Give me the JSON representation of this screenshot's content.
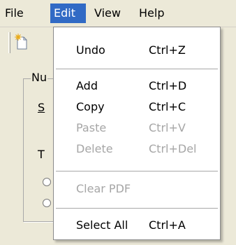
{
  "menubar": {
    "items": [
      {
        "label": "File"
      },
      {
        "label": "Edit"
      },
      {
        "label": "View"
      },
      {
        "label": "Help"
      }
    ]
  },
  "background": {
    "group_label": "Nu",
    "label_s": "S",
    "label_t": "T"
  },
  "edit_menu": {
    "items": [
      {
        "label": "Undo",
        "shortcut": "Ctrl+Z",
        "enabled": true
      },
      {
        "label": "Add",
        "shortcut": "Ctrl+D",
        "enabled": true
      },
      {
        "label": "Copy",
        "shortcut": "Ctrl+C",
        "enabled": true
      },
      {
        "label": "Paste",
        "shortcut": "Ctrl+V",
        "enabled": false
      },
      {
        "label": "Delete",
        "shortcut": "Ctrl+Del",
        "enabled": false
      },
      {
        "label": "Clear PDF",
        "shortcut": "",
        "enabled": false
      },
      {
        "label": "Select All",
        "shortcut": "Ctrl+A",
        "enabled": true
      }
    ]
  },
  "colors": {
    "highlight": "#316ac5",
    "disabled_text": "#a6a6a6",
    "menu_background": "#ffffff",
    "window_background": "#ece9d8"
  }
}
